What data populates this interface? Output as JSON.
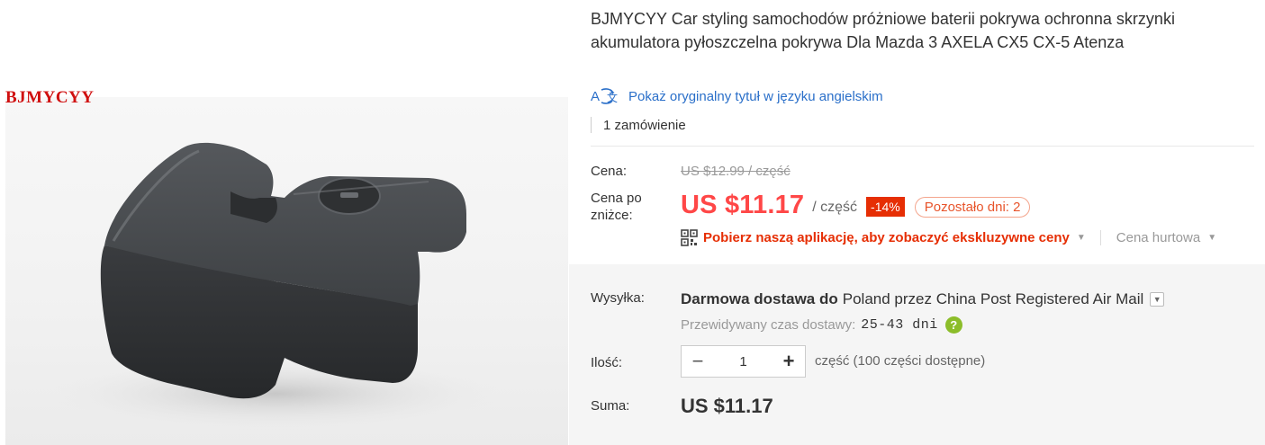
{
  "product": {
    "brand_watermark": "BJMYCYY",
    "title": "BJMYCYY Car styling samochodów próżniowe baterii pokrywa ochronna skrzynki akumulatora pyłoszczelna pokrywa Dla Mazda 3 AXELA CX5 CX-5 Atenza",
    "translate_link": "Pokaż oryginalny tytuł w języku angielskim",
    "orders": "1 zamówienie"
  },
  "price": {
    "label": "Cena:",
    "original": "US $12.99 / część",
    "discount_label": "Cena po zniżce:",
    "current": "US $11.17",
    "unit": "/ część",
    "discount_badge": "-14%",
    "days_left": "Pozostało dni: 2",
    "app_promo": "Pobierz naszą aplikację, aby zobaczyć ekskluzywne ceny",
    "wholesale": "Cena hurtowa"
  },
  "shipping": {
    "label": "Wysyłka:",
    "free_text": "Darmowa dostawa do",
    "destination": "Poland przez China Post Registered Air Mail",
    "delivery_label": "Przewidywany czas dostawy:",
    "delivery_days": "25-43 dni"
  },
  "quantity": {
    "label": "Ilość:",
    "minus": "−",
    "value": "1",
    "plus": "+",
    "note": "część (100 części dostępne)"
  },
  "total": {
    "label": "Suma:",
    "value": "US $11.17"
  },
  "colors": {
    "price": "#ff4747",
    "badge": "#e62e04",
    "link": "#2a6fc9",
    "help": "#8cbd2a"
  },
  "icons": [
    "translate-icon",
    "qr-code-icon",
    "caret-down-icon",
    "dropdown-icon",
    "help-icon",
    "minus-icon",
    "plus-icon"
  ]
}
